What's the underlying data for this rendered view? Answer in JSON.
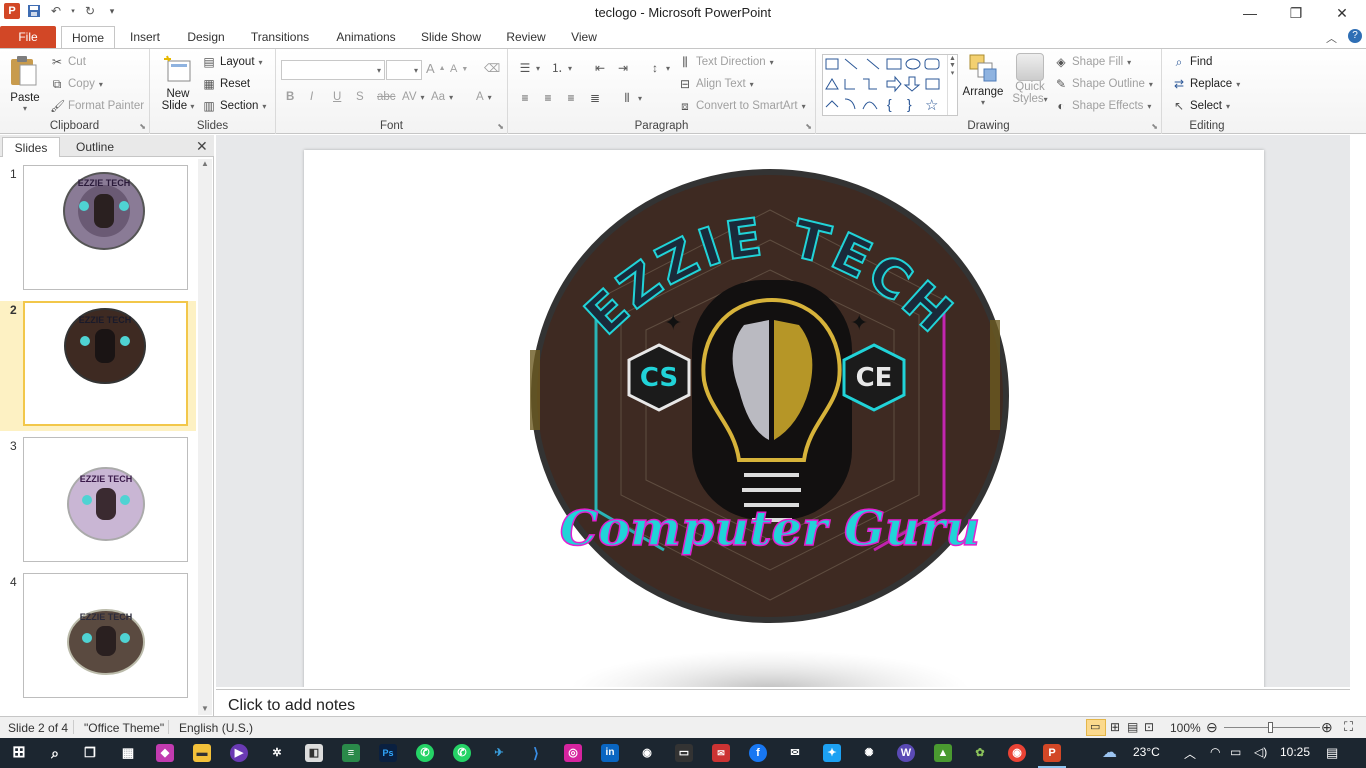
{
  "window": {
    "title": "teclogo  -  Microsoft PowerPoint",
    "app_icon": "P",
    "controls": {
      "minimize": "minimize-icon",
      "restore": "restore-icon",
      "close": "close-icon"
    }
  },
  "tabs": [
    "File",
    "Home",
    "Insert",
    "Design",
    "Transitions",
    "Animations",
    "Slide Show",
    "Review",
    "View"
  ],
  "ribbon": {
    "clipboard": {
      "label": "Clipboard",
      "paste": "Paste",
      "cut": "Cut",
      "copy": "Copy",
      "format_painter": "Format Painter"
    },
    "slides": {
      "label": "Slides",
      "new_slide_1": "New",
      "new_slide_2": "Slide",
      "layout": "Layout",
      "reset": "Reset",
      "section": "Section"
    },
    "font": {
      "label": "Font",
      "font_value": "",
      "size_value": ""
    },
    "paragraph": {
      "label": "Paragraph",
      "text_direction": "Text Direction",
      "align_text": "Align Text",
      "convert_smartart": "Convert to SmartArt"
    },
    "drawing": {
      "label": "Drawing",
      "arrange": "Arrange",
      "quick_styles_1": "Quick",
      "quick_styles_2": "Styles",
      "shape_fill": "Shape Fill",
      "shape_outline": "Shape Outline",
      "shape_effects": "Shape Effects"
    },
    "editing": {
      "label": "Editing",
      "find": "Find",
      "replace": "Replace",
      "select": "Select"
    }
  },
  "left_panel": {
    "tabs": [
      "Slides",
      "Outline"
    ],
    "close": "close-icon",
    "thumbnails": [
      {
        "number": "1",
        "selected": false
      },
      {
        "number": "2",
        "selected": true
      },
      {
        "number": "3",
        "selected": false
      },
      {
        "number": "4",
        "selected": false
      }
    ]
  },
  "slide": {
    "logo_top_text": "EZZIE TECH",
    "logo_bottom_text": "Computer Guru",
    "left_badge": "CS",
    "right_badge": "CE"
  },
  "notes": {
    "placeholder": "Click to add notes"
  },
  "status": {
    "slide_info": "Slide 2 of 4",
    "theme": "\"Office Theme\"",
    "language": "English (U.S.)",
    "zoom": "100%"
  },
  "taskbar": {
    "weather": "23°C",
    "time": "10:25"
  },
  "colors": {
    "ppt_orange": "#d24726",
    "selection": "#fdf1c3",
    "logo_cyan": "#21d3d8",
    "logo_magenta": "#e020d0",
    "logo_brown": "#3e2a22"
  }
}
